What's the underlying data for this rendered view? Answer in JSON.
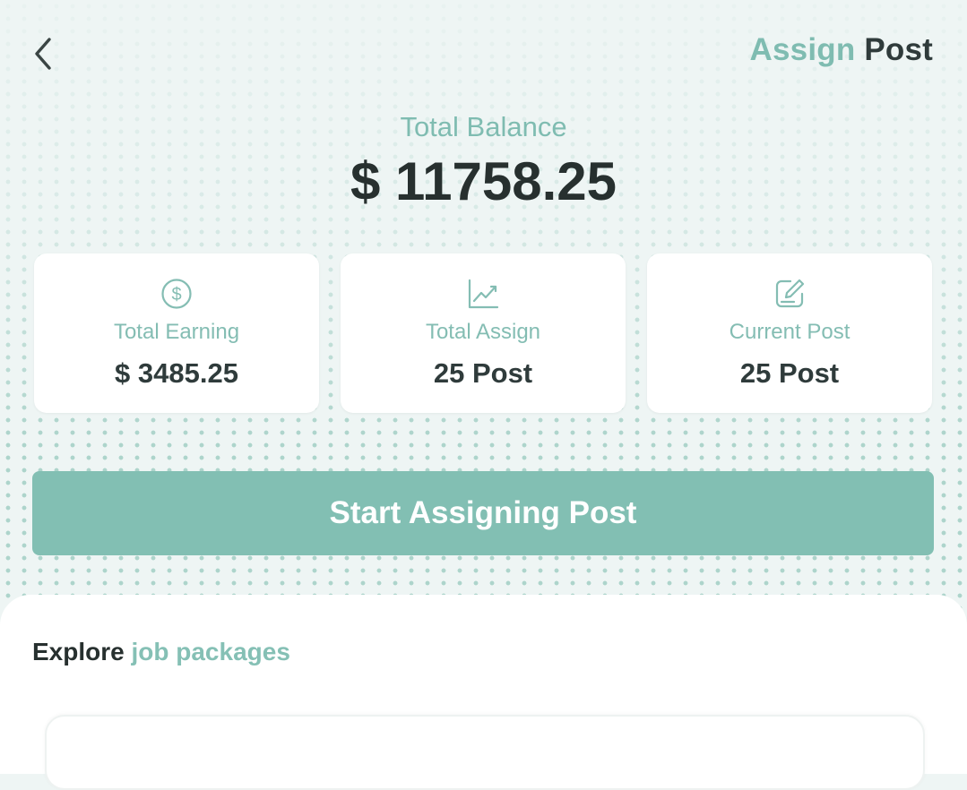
{
  "header": {
    "title_accent": "Assign",
    "title_main": "Post"
  },
  "balance": {
    "label": "Total Balance",
    "value": "$ 11758.25"
  },
  "stats": [
    {
      "icon": "dollar-circle-icon",
      "label": "Total Earning",
      "value": "$ 3485.25"
    },
    {
      "icon": "line-chart-icon",
      "label": "Total Assign",
      "value": "25 Post"
    },
    {
      "icon": "edit-note-icon",
      "label": "Current Post",
      "value": "25 Post"
    }
  ],
  "cta": {
    "label": "Start Assigning Post"
  },
  "explore": {
    "prefix": "Explore",
    "accent": "job packages"
  },
  "colors": {
    "accent": "#82bfb3",
    "text_dark": "#2f3b3b",
    "background": "#eef5f4"
  }
}
